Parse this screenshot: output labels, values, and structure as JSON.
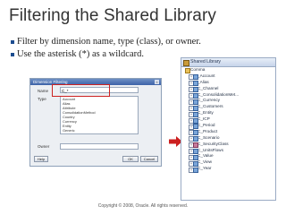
{
  "slide": {
    "title": "Filtering the Shared Library",
    "bullets": [
      "Filter by dimension name, type (class), or owner.",
      "Use the asterisk (*) as a wildcard."
    ],
    "copyright": "Copyright © 2008, Oracle. All rights reserved."
  },
  "dialog": {
    "title": "Dimension Filtering",
    "name_label": "Name",
    "name_value": "C_*",
    "type_label": "Type",
    "type_options": [
      "Account",
      "Alias",
      "Attribute",
      "ConsolidationMethod",
      "Country",
      "Currency",
      "Entity",
      "Generic"
    ],
    "owner_label": "Owner",
    "owner_value": "",
    "help_label": "Help",
    "ok_label": "OK",
    "cancel_label": "Cancel"
  },
  "library": {
    "title": "Shared Library",
    "root": "Comma",
    "items": [
      {
        "label": "_Account",
        "kind": "dim"
      },
      {
        "label": "_Alias",
        "kind": "dim"
      },
      {
        "label": "C_Channel",
        "kind": "dim"
      },
      {
        "label": "C_ConsolidationMet...",
        "kind": "dim"
      },
      {
        "label": "C_Currency",
        "kind": "dim"
      },
      {
        "label": "C_Customers",
        "kind": "dim"
      },
      {
        "label": "C_Entity",
        "kind": "dim"
      },
      {
        "label": "C_ICP",
        "kind": "dim"
      },
      {
        "label": "C_Period",
        "kind": "dim"
      },
      {
        "label": "C_Product",
        "kind": "dim"
      },
      {
        "label": "C_Scenario",
        "kind": "dim"
      },
      {
        "label": "C_SecurityClass",
        "kind": "cls"
      },
      {
        "label": "C_UnitsFlows",
        "kind": "dim"
      },
      {
        "label": "C_Value",
        "kind": "dim"
      },
      {
        "label": "C_View",
        "kind": "dim"
      },
      {
        "label": "C_Year",
        "kind": "dim"
      }
    ]
  },
  "colors": {
    "callout": "#cc2222",
    "arrow": "#cc1f1f",
    "bullet": "#1d4d8f"
  }
}
